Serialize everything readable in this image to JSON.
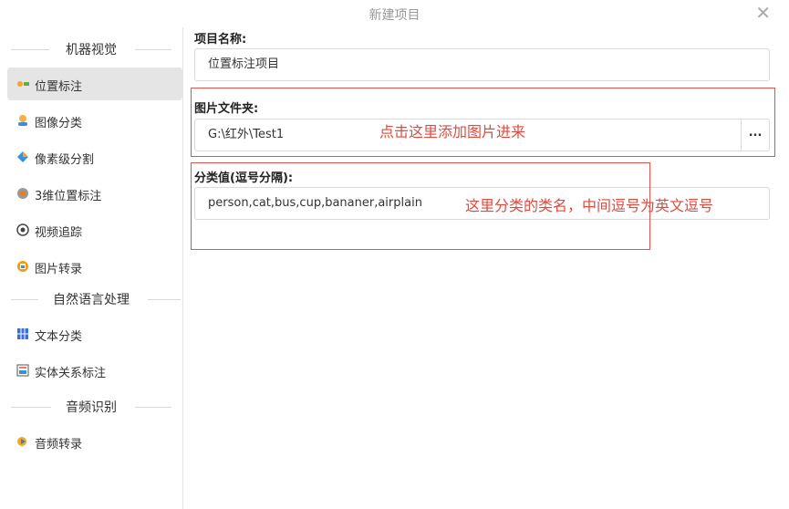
{
  "window": {
    "title": "新建项目"
  },
  "sidebar": {
    "sections": [
      {
        "title": "机器视觉",
        "items": [
          {
            "label": "位置标注",
            "icon": "tag-icon",
            "active": true
          },
          {
            "label": "图像分类",
            "icon": "classify-icon"
          },
          {
            "label": "像素级分割",
            "icon": "segment-icon"
          },
          {
            "label": "3维位置标注",
            "icon": "cube-icon"
          },
          {
            "label": "视频追踪",
            "icon": "video-icon"
          },
          {
            "label": "图片转录",
            "icon": "image-icon"
          }
        ]
      },
      {
        "title": "自然语言处理",
        "items": [
          {
            "label": "文本分类",
            "icon": "grid-icon"
          },
          {
            "label": "实体关系标注",
            "icon": "relation-icon"
          }
        ]
      },
      {
        "title": "音频识别",
        "items": [
          {
            "label": "音频转录",
            "icon": "audio-icon"
          }
        ]
      }
    ]
  },
  "form": {
    "project_name": {
      "label": "项目名称:",
      "value": "位置标注项目"
    },
    "image_folder": {
      "label": "图片文件夹:",
      "value": "G:\\红外\\Test1",
      "browse_label": "..."
    },
    "categories": {
      "label": "分类值(逗号分隔):",
      "value": "person,cat,bus,cup,bananer,airplain"
    }
  },
  "annotations": {
    "folder_hint": "点击这里添加图片进来",
    "category_hint": "这里分类的类名，中间逗号为英文逗号"
  },
  "colors": {
    "annotation_red": "#e5534b",
    "active_bg": "#e5e5e5"
  }
}
